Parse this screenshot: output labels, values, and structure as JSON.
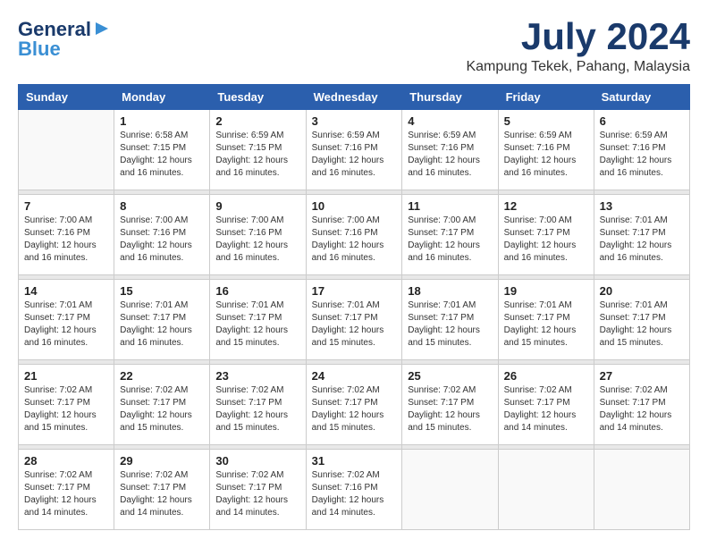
{
  "header": {
    "logo_general": "General",
    "logo_blue": "Blue",
    "month_title": "July 2024",
    "location": "Kampung Tekek, Pahang, Malaysia"
  },
  "calendar": {
    "days_of_week": [
      "Sunday",
      "Monday",
      "Tuesday",
      "Wednesday",
      "Thursday",
      "Friday",
      "Saturday"
    ],
    "weeks": [
      [
        {
          "day": "",
          "info": ""
        },
        {
          "day": "1",
          "info": "Sunrise: 6:58 AM\nSunset: 7:15 PM\nDaylight: 12 hours and 16 minutes."
        },
        {
          "day": "2",
          "info": "Sunrise: 6:59 AM\nSunset: 7:15 PM\nDaylight: 12 hours and 16 minutes."
        },
        {
          "day": "3",
          "info": "Sunrise: 6:59 AM\nSunset: 7:16 PM\nDaylight: 12 hours and 16 minutes."
        },
        {
          "day": "4",
          "info": "Sunrise: 6:59 AM\nSunset: 7:16 PM\nDaylight: 12 hours and 16 minutes."
        },
        {
          "day": "5",
          "info": "Sunrise: 6:59 AM\nSunset: 7:16 PM\nDaylight: 12 hours and 16 minutes."
        },
        {
          "day": "6",
          "info": "Sunrise: 6:59 AM\nSunset: 7:16 PM\nDaylight: 12 hours and 16 minutes."
        }
      ],
      [
        {
          "day": "7",
          "info": ""
        },
        {
          "day": "8",
          "info": "Sunrise: 7:00 AM\nSunset: 7:16 PM\nDaylight: 12 hours and 16 minutes."
        },
        {
          "day": "9",
          "info": "Sunrise: 7:00 AM\nSunset: 7:16 PM\nDaylight: 12 hours and 16 minutes."
        },
        {
          "day": "10",
          "info": "Sunrise: 7:00 AM\nSunset: 7:16 PM\nDaylight: 12 hours and 16 minutes."
        },
        {
          "day": "11",
          "info": "Sunrise: 7:00 AM\nSunset: 7:17 PM\nDaylight: 12 hours and 16 minutes."
        },
        {
          "day": "12",
          "info": "Sunrise: 7:00 AM\nSunset: 7:17 PM\nDaylight: 12 hours and 16 minutes."
        },
        {
          "day": "13",
          "info": "Sunrise: 7:01 AM\nSunset: 7:17 PM\nDaylight: 12 hours and 16 minutes."
        }
      ],
      [
        {
          "day": "14",
          "info": ""
        },
        {
          "day": "15",
          "info": "Sunrise: 7:01 AM\nSunset: 7:17 PM\nDaylight: 12 hours and 16 minutes."
        },
        {
          "day": "16",
          "info": "Sunrise: 7:01 AM\nSunset: 7:17 PM\nDaylight: 12 hours and 15 minutes."
        },
        {
          "day": "17",
          "info": "Sunrise: 7:01 AM\nSunset: 7:17 PM\nDaylight: 12 hours and 15 minutes."
        },
        {
          "day": "18",
          "info": "Sunrise: 7:01 AM\nSunset: 7:17 PM\nDaylight: 12 hours and 15 minutes."
        },
        {
          "day": "19",
          "info": "Sunrise: 7:01 AM\nSunset: 7:17 PM\nDaylight: 12 hours and 15 minutes."
        },
        {
          "day": "20",
          "info": "Sunrise: 7:01 AM\nSunset: 7:17 PM\nDaylight: 12 hours and 15 minutes."
        }
      ],
      [
        {
          "day": "21",
          "info": ""
        },
        {
          "day": "22",
          "info": "Sunrise: 7:02 AM\nSunset: 7:17 PM\nDaylight: 12 hours and 15 minutes."
        },
        {
          "day": "23",
          "info": "Sunrise: 7:02 AM\nSunset: 7:17 PM\nDaylight: 12 hours and 15 minutes."
        },
        {
          "day": "24",
          "info": "Sunrise: 7:02 AM\nSunset: 7:17 PM\nDaylight: 12 hours and 15 minutes."
        },
        {
          "day": "25",
          "info": "Sunrise: 7:02 AM\nSunset: 7:17 PM\nDaylight: 12 hours and 15 minutes."
        },
        {
          "day": "26",
          "info": "Sunrise: 7:02 AM\nSunset: 7:17 PM\nDaylight: 12 hours and 14 minutes."
        },
        {
          "day": "27",
          "info": "Sunrise: 7:02 AM\nSunset: 7:17 PM\nDaylight: 12 hours and 14 minutes."
        }
      ],
      [
        {
          "day": "28",
          "info": "Sunrise: 7:02 AM\nSunset: 7:17 PM\nDaylight: 12 hours and 14 minutes."
        },
        {
          "day": "29",
          "info": "Sunrise: 7:02 AM\nSunset: 7:17 PM\nDaylight: 12 hours and 14 minutes."
        },
        {
          "day": "30",
          "info": "Sunrise: 7:02 AM\nSunset: 7:17 PM\nDaylight: 12 hours and 14 minutes."
        },
        {
          "day": "31",
          "info": "Sunrise: 7:02 AM\nSunset: 7:16 PM\nDaylight: 12 hours and 14 minutes."
        },
        {
          "day": "",
          "info": ""
        },
        {
          "day": "",
          "info": ""
        },
        {
          "day": "",
          "info": ""
        }
      ]
    ],
    "week7_sunrise": "Sunrise: 7:00 AM",
    "week7_sunset": "Sunset: 7:16 PM",
    "week7_daylight": "Daylight: 12 hours and 16 minutes.",
    "week14_sunrise": "Sunrise: 7:01 AM",
    "week14_sunset": "Sunset: 7:17 PM",
    "week14_daylight": "Daylight: 12 hours and 16 minutes.",
    "week21_sunrise": "Sunrise: 7:02 AM",
    "week21_sunset": "Sunset: 7:17 PM",
    "week21_daylight": "Daylight: 12 hours and 15 minutes."
  }
}
